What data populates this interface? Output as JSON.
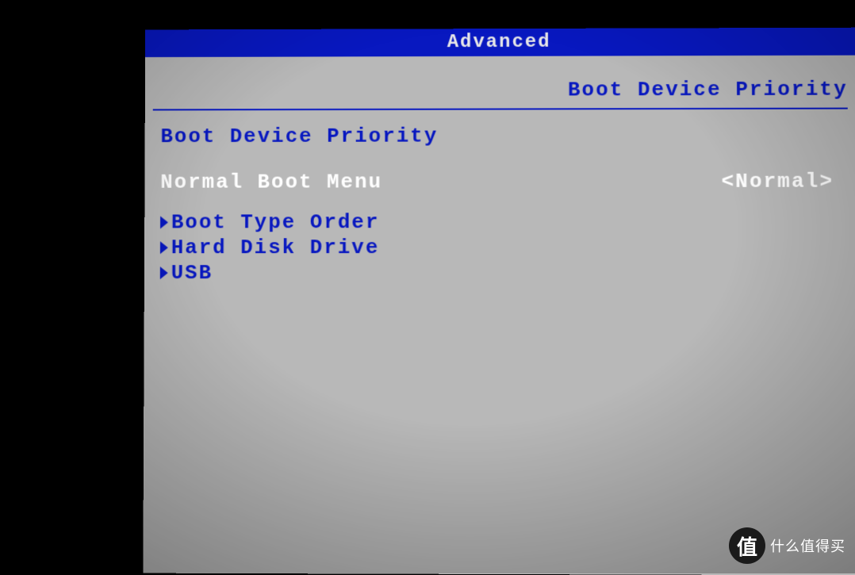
{
  "header": {
    "tab": "Advanced"
  },
  "page": {
    "title": "Boot Device Priority"
  },
  "section": {
    "title": "Boot Device Priority"
  },
  "normal_boot": {
    "label": "Normal Boot Menu",
    "value": "<Normal>"
  },
  "submenus": [
    {
      "label": "Boot Type Order"
    },
    {
      "label": "Hard Disk Drive"
    },
    {
      "label": "USB"
    }
  ],
  "watermark": {
    "icon": "值",
    "text": "什么值得买"
  }
}
